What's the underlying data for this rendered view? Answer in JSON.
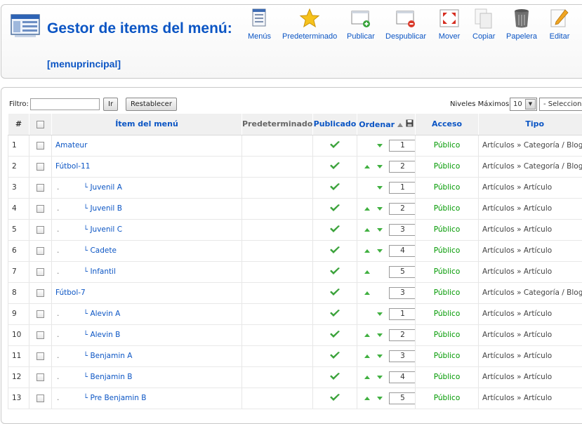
{
  "header": {
    "title": "Gestor de items del menú:",
    "menu_name": "[menuprincipal]"
  },
  "toolbar": [
    {
      "label": "Menús",
      "icon": "menus-icon"
    },
    {
      "label": "Predeterminado",
      "icon": "star-icon"
    },
    {
      "label": "Publicar",
      "icon": "publish-icon"
    },
    {
      "label": "Despublicar",
      "icon": "unpublish-icon"
    },
    {
      "label": "Mover",
      "icon": "move-icon"
    },
    {
      "label": "Copiar",
      "icon": "copy-icon"
    },
    {
      "label": "Papelera",
      "icon": "trash-icon"
    },
    {
      "label": "Editar",
      "icon": "edit-icon"
    }
  ],
  "filter": {
    "label": "Filtro:",
    "value": "",
    "go_label": "Ir",
    "reset_label": "Restablecer",
    "levels_label": "Niveles Máximos.",
    "levels_value": "10",
    "state_value": "- Seleccionar -"
  },
  "table": {
    "headers": {
      "num": "#",
      "item": "Ítem del menú",
      "default": "Predeterminado",
      "published": "Publicado",
      "order": "Ordenar",
      "access": "Acceso",
      "type": "Tipo"
    },
    "rows": [
      {
        "num": "1",
        "name": "Amateur",
        "level": 0,
        "up": false,
        "down": true,
        "order": "1",
        "access": "Público",
        "type": "Artículos » Categoría / Blog"
      },
      {
        "num": "2",
        "name": "Fútbol-11",
        "level": 0,
        "up": true,
        "down": true,
        "order": "2",
        "access": "Público",
        "type": "Artículos » Categoría / Blog"
      },
      {
        "num": "3",
        "name": "Juvenil A",
        "level": 1,
        "up": false,
        "down": true,
        "order": "1",
        "access": "Público",
        "type": "Artículos » Artículo"
      },
      {
        "num": "4",
        "name": "Juvenil B",
        "level": 1,
        "up": true,
        "down": true,
        "order": "2",
        "access": "Público",
        "type": "Artículos » Artículo"
      },
      {
        "num": "5",
        "name": "Juvenil C",
        "level": 1,
        "up": true,
        "down": true,
        "order": "3",
        "access": "Público",
        "type": "Artículos » Artículo"
      },
      {
        "num": "6",
        "name": "Cadete",
        "level": 1,
        "up": true,
        "down": true,
        "order": "4",
        "access": "Público",
        "type": "Artículos » Artículo"
      },
      {
        "num": "7",
        "name": "Infantil",
        "level": 1,
        "up": true,
        "down": false,
        "order": "5",
        "access": "Público",
        "type": "Artículos » Artículo"
      },
      {
        "num": "8",
        "name": "Fútbol-7",
        "level": 0,
        "up": true,
        "down": false,
        "order": "3",
        "access": "Público",
        "type": "Artículos » Categoría / Blog"
      },
      {
        "num": "9",
        "name": "Alevin A",
        "level": 1,
        "up": false,
        "down": true,
        "order": "1",
        "access": "Público",
        "type": "Artículos » Artículo"
      },
      {
        "num": "10",
        "name": "Alevin B",
        "level": 1,
        "up": true,
        "down": true,
        "order": "2",
        "access": "Público",
        "type": "Artículos » Artículo"
      },
      {
        "num": "11",
        "name": "Benjamin A",
        "level": 1,
        "up": true,
        "down": true,
        "order": "3",
        "access": "Público",
        "type": "Artículos » Artículo"
      },
      {
        "num": "12",
        "name": "Benjamin B",
        "level": 1,
        "up": true,
        "down": true,
        "order": "4",
        "access": "Público",
        "type": "Artículos » Artículo"
      },
      {
        "num": "13",
        "name": "Pre Benjamin B",
        "level": 1,
        "up": true,
        "down": true,
        "order": "5",
        "access": "Público",
        "type": "Artículos » Artículo"
      }
    ]
  },
  "colors": {
    "link": "#0b55c4",
    "published_check": "#3aa23a",
    "access": "#009900"
  }
}
